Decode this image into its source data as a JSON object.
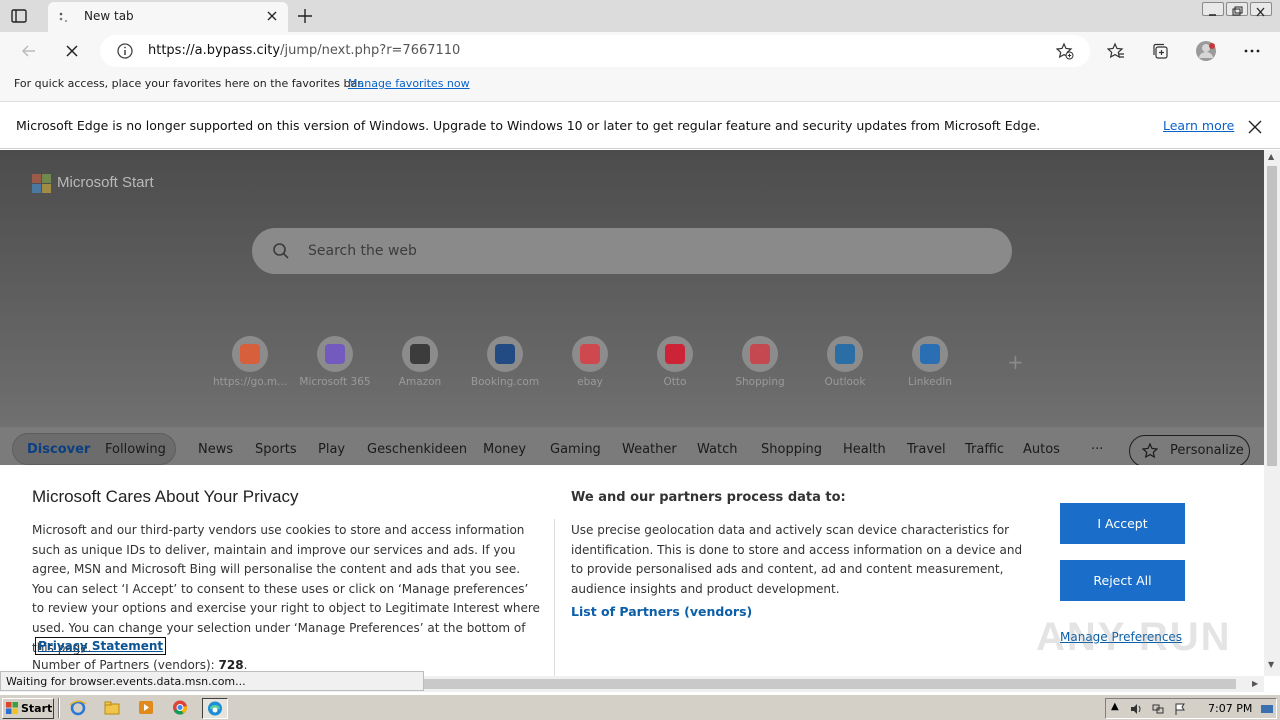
{
  "browser": {
    "tab_title": "New tab",
    "url_host": "https://a.bypass.city",
    "url_path": "/jump/next.php?r=7667110",
    "favorites_bar_text": "For quick access, place your favorites here on the favorites bar.",
    "favorites_bar_link": "Manage favorites now",
    "infobar_text": "Microsoft Edge is no longer supported on this version of Windows. Upgrade to Windows 10 or later to get regular feature and security updates from Microsoft Edge.",
    "infobar_link": "Learn more",
    "status_text": "Waiting for browser.events.data.msn.com..."
  },
  "start_page": {
    "brand": "Microsoft Start",
    "search_placeholder": "Search the web",
    "tiles": [
      {
        "label": "https://go.m...",
        "icon": "windows-tile-icon",
        "color": "#f25022"
      },
      {
        "label": "Microsoft 365",
        "icon": "microsoft-365-icon",
        "color": "#6a4ad0"
      },
      {
        "label": "Amazon",
        "icon": "amazon-icon",
        "color": "#222222"
      },
      {
        "label": "Booking.com",
        "icon": "booking-icon",
        "color": "#003580"
      },
      {
        "label": "ebay",
        "icon": "ebay-icon",
        "color": "#e53238"
      },
      {
        "label": "Otto",
        "icon": "otto-icon",
        "color": "#e2001a"
      },
      {
        "label": "Shopping",
        "icon": "shopping-bag-icon",
        "color": "#d8323c"
      },
      {
        "label": "Outlook",
        "icon": "outlook-icon",
        "color": "#0a64ad"
      },
      {
        "label": "LinkedIn",
        "icon": "linkedin-icon",
        "color": "#0a66c2"
      }
    ],
    "feed_nav": [
      "Discover",
      "Following",
      "News",
      "Sports",
      "Play",
      "Geschenkideen",
      "Money",
      "Gaming",
      "Weather",
      "Watch",
      "Shopping",
      "Health",
      "Travel",
      "Traffic",
      "Autos",
      "···"
    ],
    "personalize": "Personalize"
  },
  "consent": {
    "title": "Microsoft Cares About Your Privacy",
    "body": "Microsoft and our third-party vendors use cookies to store and access information such as unique IDs to deliver, maintain and improve our services and ads. If you agree, MSN and Microsoft Bing will personalise the content and ads that you see. You can select ‘I Accept’ to consent to these uses or click on ‘Manage preferences’ to review your options and exercise your right to object to Legitimate Interest where used.  You can change your selection under ‘Manage Preferences’ at the bottom of this page.",
    "privacy_link": "Privacy Statement",
    "partners_label": "Number of Partners (vendors): ",
    "partners_count": "728",
    "partners_suffix": ".",
    "purpose_heading": "We and our partners process data to:",
    "purpose_text": "Use precise geolocation data and actively scan device characteristics for identification. This is done to store and access information on a device and to provide personalised ads and content, ad and content measurement, audience insights and product development.",
    "list_link": "List of Partners (vendors)",
    "accept": "I Accept",
    "reject": "Reject All",
    "manage": "Manage Preferences",
    "watermark": "ANY RUN"
  },
  "taskbar": {
    "start": "Start",
    "clock": "7:07 PM"
  }
}
